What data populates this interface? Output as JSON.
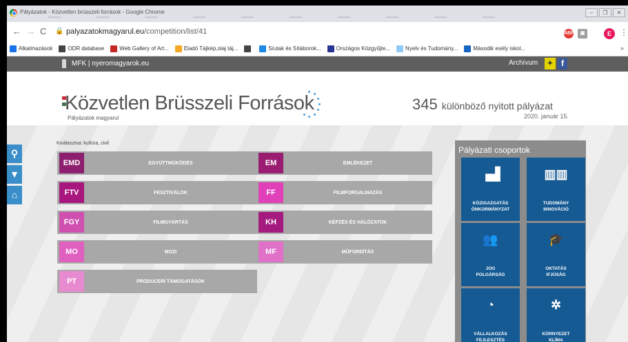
{
  "browser": {
    "window_title": "Pályázatok - Közvetlen brüsszeli források - Google Chrome",
    "url_host": "palyazatokmagyarul.eu",
    "url_path": "/competition/list/41",
    "profile_initial": "E",
    "bookmarks": [
      {
        "label": "Alkalmazások",
        "icon": "apps-grid-icon",
        "color": "#1a73e8"
      },
      {
        "label": "ODR database",
        "icon": "globe-icon",
        "color": "#444444"
      },
      {
        "label": "Web Gallery of Art...",
        "icon": "wga-icon",
        "color": "#c62828"
      },
      {
        "label": "Eladó Tájkép,olaj táj...",
        "icon": "brush-icon",
        "color": "#f5a623"
      },
      {
        "label": "",
        "icon": "globe-icon",
        "color": "#444444"
      },
      {
        "label": "Síutak és Sítáborok...",
        "icon": "snowflake-icon",
        "color": "#1e88e5"
      },
      {
        "label": "Országos Közgyűjte...",
        "icon": "library-icon",
        "color": "#283593"
      },
      {
        "label": "Nyelv és Tudomány...",
        "icon": "page-icon",
        "color": "#90caf9"
      },
      {
        "label": "Második esély iskol...",
        "icon": "school-icon",
        "color": "#1565c0"
      }
    ]
  },
  "site": {
    "brand": "MFK | nyeromagyarok.eu",
    "archive": "Archívum",
    "logo_title": "Közvetlen Brüsszeli Források",
    "logo_sub": "Pályázatok magyarul",
    "count_number": "345",
    "count_text": "különböző nyitott pályázat",
    "date": "2020. január 15.",
    "selected": "Kiválasztva: kultúra, civil"
  },
  "categories_left": [
    {
      "code": "EMD",
      "label": "Együttműködés",
      "color": "#8e1f6f"
    },
    {
      "code": "FTV",
      "label": "Fesztiválok",
      "color": "#a8177e"
    },
    {
      "code": "FGY",
      "label": "Filmgyártás",
      "color": "#d050b0"
    },
    {
      "code": "MO",
      "label": "Mozi",
      "color": "#e060c0"
    },
    {
      "code": "PT",
      "label": "Producerí támogatások",
      "color": "#e88ad0"
    }
  ],
  "categories_right": [
    {
      "code": "EM",
      "label": "Emlékezet",
      "color": "#9a1d72"
    },
    {
      "code": "FF",
      "label": "Filmforgalmazás",
      "color": "#e040b8"
    },
    {
      "code": "KH",
      "label": "Képzés és hálózatok",
      "color": "#a51a7e"
    },
    {
      "code": "MF",
      "label": "Műfordítás",
      "color": "#e070c8"
    }
  ],
  "groups": {
    "title": "Pályázati csoportok",
    "tiles": [
      {
        "l1": "KÖZIGAZGATÁS",
        "l2": "ÖNKORMÁNYZAT",
        "icon": "bar-chart-icon",
        "glyph": "▗▟"
      },
      {
        "l1": "TUDOMÁNY",
        "l2": "INNOVÁCIÓ",
        "icon": "building-icon",
        "glyph": "▥▥"
      },
      {
        "l1": "JOG",
        "l2": "POLGÁRSÁG",
        "icon": "people-icon",
        "glyph": "👥"
      },
      {
        "l1": "OKTATÁS",
        "l2": "IFJÚSÁG",
        "icon": "graduation-icon",
        "glyph": "🎓"
      },
      {
        "l1": "VÁLLALKOZÁS",
        "l2": "FEJLESZTÉS",
        "icon": "pie-chart-icon",
        "glyph": "◔"
      },
      {
        "l1": "KÖRNYEZET",
        "l2": "KLÍMA",
        "icon": "wind-turbine-icon",
        "glyph": "✲"
      }
    ]
  }
}
